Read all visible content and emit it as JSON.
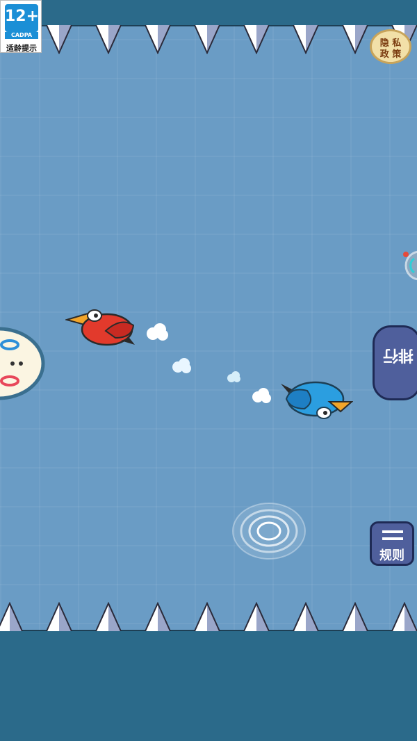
{
  "age_badge": {
    "rating": "12+",
    "org": "CADPA",
    "tip": "适龄提示"
  },
  "privacy": {
    "line1": "隐 私",
    "line2": "政 策"
  },
  "rank_tab": {
    "label": "排行"
  },
  "rules": {
    "label": "规则"
  },
  "colors": {
    "background": "#6a9cc5",
    "bar": "#2b6a8a",
    "red_bird": "#e23a2c",
    "blue_bird": "#2b9ee0",
    "button": "#4f5f9c"
  },
  "icons": [
    "spike-row",
    "red-bird",
    "blue-bird",
    "white-puff",
    "tap-ripple",
    "menu-icon",
    "face-character"
  ]
}
